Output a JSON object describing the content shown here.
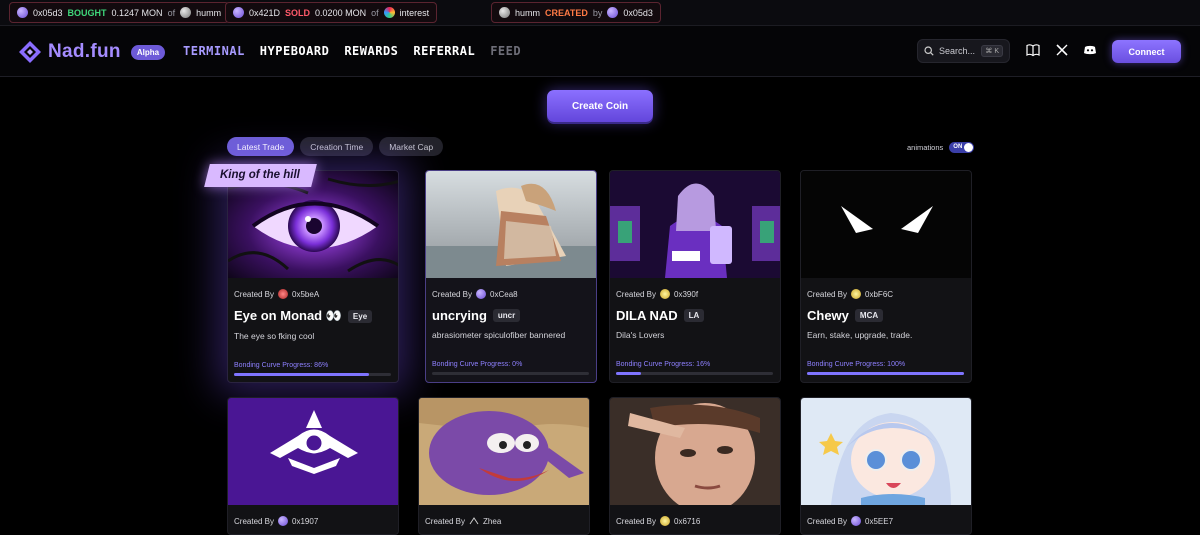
{
  "ticker": [
    {
      "addr": "0x05d3",
      "action": "BOUGHT",
      "amount": "0.1247 MON",
      "joiner": "of",
      "token": "humm"
    },
    {
      "addr": "0x421D",
      "action": "SOLD",
      "amount": "0.0200 MON",
      "joiner": "of",
      "token": "interest"
    },
    {
      "addr": "humm",
      "action": "CREATED",
      "joiner": "by",
      "token": "0x05d3"
    }
  ],
  "header": {
    "logo": "Nad.fun",
    "badge": "Alpha",
    "nav": [
      "TERMINAL",
      "HYPEBOARD",
      "REWARDS",
      "REFERRAL",
      "FEED"
    ],
    "search_label": "Search...",
    "search_shortcut": "⌘ K",
    "connect": "Connect"
  },
  "create_coin": "Create Coin",
  "tabs": [
    "Latest Trade",
    "Creation Time",
    "Market Cap"
  ],
  "animations": {
    "label": "animations",
    "toggle": "ON"
  },
  "king_label": "King of the hill",
  "created_by_label": "Created By",
  "progress_label": "Bonding Curve Progress:",
  "cards": [
    {
      "creator": "0x5beA",
      "name": "Eye on Monad 👀",
      "symbol": "Eye",
      "desc": "The eye so fking cool",
      "progress": "86%",
      "progress_value": 86
    },
    {
      "creator": "0xCea8",
      "name": "uncrying",
      "symbol": "uncr",
      "desc": "abrasiometer spiculofiber bannered",
      "progress": "0%",
      "progress_value": 0
    },
    {
      "creator": "0x390f",
      "name": "DILA NAD",
      "symbol": "LA",
      "desc": "Dila's Lovers",
      "progress": "16%",
      "progress_value": 16
    },
    {
      "creator": "0xbF6C",
      "name": "Chewy",
      "symbol": "MCA",
      "desc": "Earn, stake, upgrade, trade.",
      "progress": "100%",
      "progress_value": 100
    },
    {
      "creator": "0x1907"
    },
    {
      "creator": "Zhea"
    },
    {
      "creator": "0x6716"
    },
    {
      "creator": "0x5EE7"
    }
  ]
}
